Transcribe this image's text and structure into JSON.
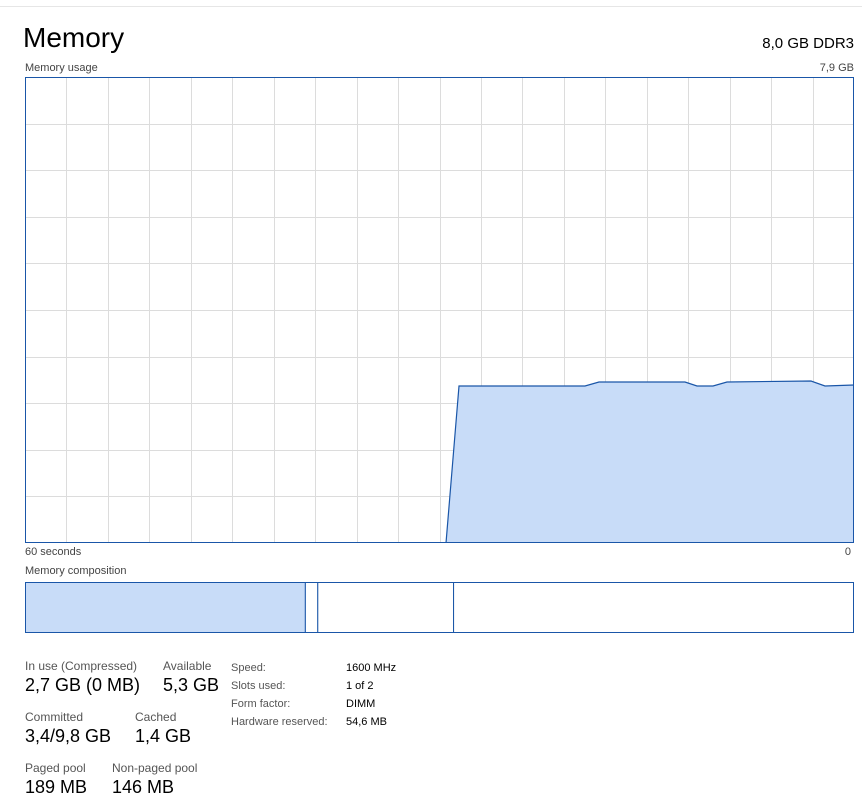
{
  "header": {
    "title": "Memory",
    "spec": "8,0 GB DDR3"
  },
  "graph": {
    "label": "Memory usage",
    "max_label": "7,9 GB",
    "time_left": "60 seconds",
    "time_right": "0",
    "line_color": "#1a56a8",
    "fill_color": "#c8dcf8",
    "grid_color": "#dcdcdc"
  },
  "composition": {
    "label": "Memory composition",
    "in_use_fraction": 0.338,
    "modified_fraction": 0.015,
    "standby_fraction": 0.164,
    "free_fraction": 0.483
  },
  "stats": {
    "in_use_label": "In use (Compressed)",
    "in_use_value": "2,7 GB (0 MB)",
    "available_label": "Available",
    "available_value": "5,3 GB",
    "committed_label": "Committed",
    "committed_value": "3,4/9,8 GB",
    "cached_label": "Cached",
    "cached_value": "1,4 GB",
    "paged_pool_label": "Paged pool",
    "paged_pool_value": "189 MB",
    "non_paged_pool_label": "Non-paged pool",
    "non_paged_pool_value": "146 MB"
  },
  "info": {
    "speed_label": "Speed:",
    "speed_value": "1600 MHz",
    "slots_label": "Slots used:",
    "slots_value": "1 of 2",
    "form_label": "Form factor:",
    "form_value": "DIMM",
    "reserved_label": "Hardware reserved:",
    "reserved_value": "54,6 MB"
  }
}
